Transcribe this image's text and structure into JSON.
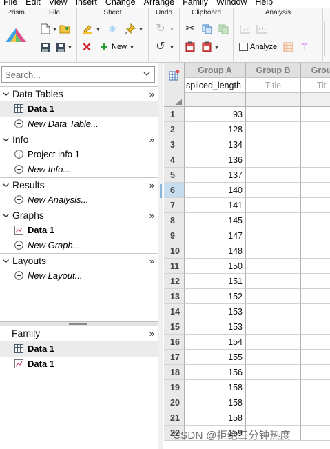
{
  "menu": [
    "File",
    "Edit",
    "View",
    "Insert",
    "Change",
    "Arrange",
    "Family",
    "Window",
    "Help"
  ],
  "ribbon": {
    "groups": {
      "prism": "Prism",
      "file": "File",
      "sheet": "Sheet",
      "undo": "Undo",
      "clipboard": "Clipboard",
      "analysis": "Analysis"
    },
    "new_label": "New",
    "analyze_label": "Analyze"
  },
  "search": {
    "placeholder": "Search..."
  },
  "navigator": {
    "more_glyph": "»",
    "sections": [
      {
        "title": "Data Tables",
        "items": [
          {
            "label": "Data 1",
            "icon": "data-table-icon",
            "bold": true,
            "selected": true
          },
          {
            "label": "New Data Table...",
            "icon": "plus-circle-icon",
            "italic": true
          }
        ]
      },
      {
        "title": "Info",
        "items": [
          {
            "label": "Project info 1",
            "icon": "info-icon"
          },
          {
            "label": "New Info...",
            "icon": "plus-circle-icon",
            "italic": true
          }
        ]
      },
      {
        "title": "Results",
        "items": [
          {
            "label": "New Analysis...",
            "icon": "plus-circle-icon",
            "italic": true
          }
        ]
      },
      {
        "title": "Graphs",
        "items": [
          {
            "label": "Data 1",
            "icon": "graph-icon",
            "bold": true
          },
          {
            "label": "New Graph...",
            "icon": "plus-circle-icon",
            "italic": true
          }
        ]
      },
      {
        "title": "Layouts",
        "items": [
          {
            "label": "New Layout...",
            "icon": "plus-circle-icon",
            "italic": true
          }
        ]
      }
    ]
  },
  "family": {
    "title": "Family",
    "items": [
      {
        "label": "Data 1",
        "icon": "data-table-icon",
        "selected": true
      },
      {
        "label": "Data 1",
        "icon": "graph-icon"
      }
    ]
  },
  "sheet": {
    "columns": [
      {
        "header": "Group A",
        "title": "spliced_length",
        "is_placeholder": false
      },
      {
        "header": "Group B",
        "title": "Title",
        "is_placeholder": true
      },
      {
        "header": "Grou",
        "title": "Tit",
        "is_placeholder": true
      }
    ],
    "rows": [
      "1",
      "2",
      "3",
      "4",
      "5",
      "6",
      "7",
      "8",
      "9",
      "10",
      "11",
      "12",
      "13",
      "14",
      "15",
      "16",
      "17",
      "18",
      "19",
      "20",
      "21",
      "22"
    ],
    "active_row": 6,
    "group_a_values": [
      "93",
      "128",
      "134",
      "136",
      "137",
      "140",
      "141",
      "145",
      "147",
      "148",
      "150",
      "151",
      "152",
      "153",
      "153",
      "154",
      "155",
      "156",
      "158",
      "158",
      "158",
      "159"
    ]
  },
  "watermark": "CSDN @拒绝三分钟热度",
  "colors": {
    "selection": "#ebebeb",
    "active_row_header": "#c6dcef",
    "header_bg": "#e0e0e0"
  }
}
